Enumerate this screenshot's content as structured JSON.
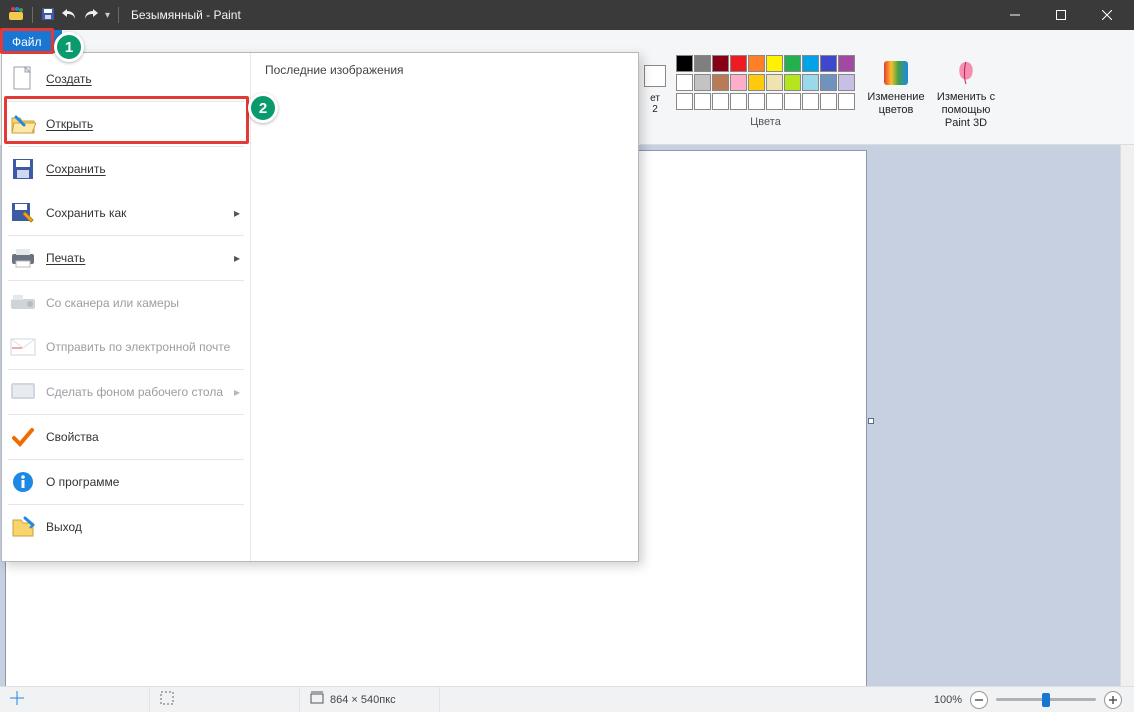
{
  "window": {
    "title": "Безымянный - Paint"
  },
  "tabs": {
    "file": "Файл"
  },
  "file_menu": {
    "recent_header": "Последние изображения",
    "items": {
      "new": "Создать",
      "open": "Открыть",
      "save": "Сохранить",
      "save_as": "Сохранить как",
      "print": "Печать",
      "scanner": "Со сканера или камеры",
      "email": "Отправить по электронной почте",
      "wallpaper": "Сделать фоном рабочего стола",
      "properties": "Свойства",
      "about": "О программе",
      "exit": "Выход"
    }
  },
  "ribbon": {
    "color_stub_label": "ет\n2",
    "edit_colors": "Изменение цветов",
    "paint3d_line1": "Изменить с",
    "paint3d_line2": "помощью Paint 3D",
    "colors_group_label": "Цвета",
    "palette_row1": [
      "#000000",
      "#7f7f7f",
      "#880015",
      "#ed1c24",
      "#ff7f27",
      "#fff200",
      "#22b14c",
      "#00a2e8",
      "#3f48cc",
      "#a349a4"
    ],
    "palette_row2": [
      "#ffffff",
      "#c3c3c3",
      "#b97a57",
      "#ffaec9",
      "#ffc90e",
      "#efe4b0",
      "#b5e61d",
      "#99d9ea",
      "#7092be",
      "#c8bfe7"
    ],
    "palette_row3": [
      "#ffffff",
      "#ffffff",
      "#ffffff",
      "#ffffff",
      "#ffffff",
      "#ffffff",
      "#ffffff",
      "#ffffff",
      "#ffffff",
      "#ffffff"
    ]
  },
  "status": {
    "canvas_size": "864 × 540пкс",
    "zoom": "100%"
  },
  "annotations": {
    "n1": "1",
    "n2": "2"
  }
}
